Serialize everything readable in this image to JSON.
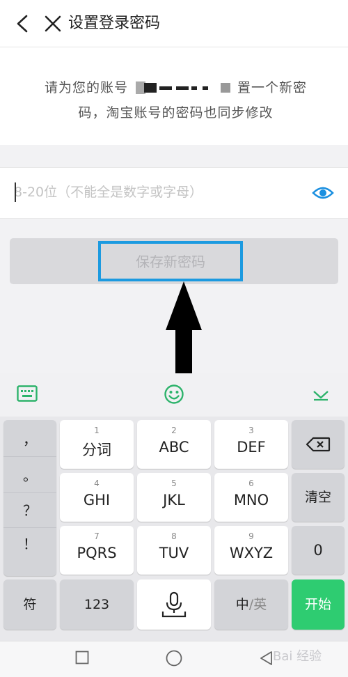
{
  "header": {
    "title": "设置登录密码"
  },
  "description": {
    "line1_prefix": "请为您的账号",
    "line1_suffix": "置一个新密",
    "line2": "码，淘宝账号的密码也同步修改"
  },
  "password": {
    "placeholder": "8-20位（不能全是数字或字母）",
    "value": ""
  },
  "save_button": {
    "label": "保存新密码"
  },
  "keyboard": {
    "punctuation": [
      "，",
      "。",
      "？",
      "！"
    ],
    "rows": [
      [
        {
          "num": "1",
          "label": "分词"
        },
        {
          "num": "2",
          "label": "ABC"
        },
        {
          "num": "3",
          "label": "DEF"
        }
      ],
      [
        {
          "num": "4",
          "label": "GHI"
        },
        {
          "num": "5",
          "label": "JKL"
        },
        {
          "num": "6",
          "label": "MNO"
        }
      ],
      [
        {
          "num": "7",
          "label": "PQRS"
        },
        {
          "num": "8",
          "label": "TUV"
        },
        {
          "num": "9",
          "label": "WXYZ"
        }
      ]
    ],
    "right_keys": {
      "clear": "清空",
      "zero": "0"
    },
    "bottom": {
      "symbols": "符",
      "numbers": "123",
      "lang_cn": "中",
      "lang_sep": "/",
      "lang_en": "英",
      "start": "开始"
    }
  },
  "watermark": {
    "text": "Bai 经验"
  },
  "colors": {
    "accent_blue": "#1c9ae0",
    "green": "#2ecc71",
    "eye_blue": "#1a8fe0"
  }
}
